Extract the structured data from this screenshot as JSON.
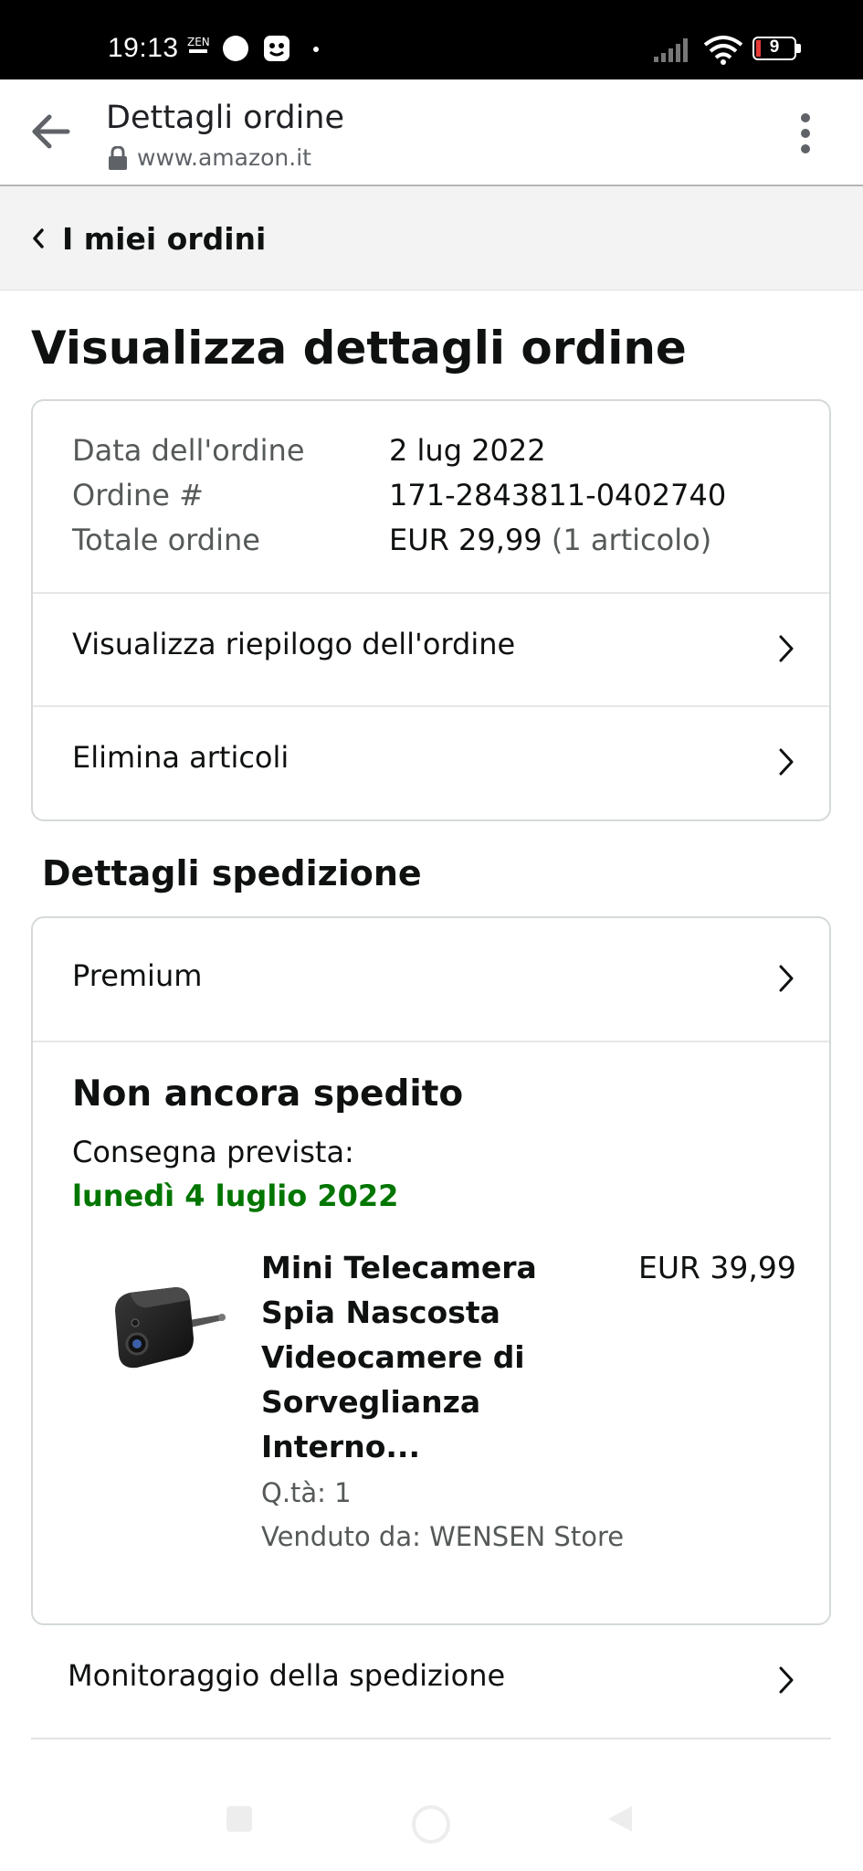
{
  "status_bar": {
    "time": "19:13",
    "zen_label_top": "ZEN",
    "battery_level": "9"
  },
  "toolbar": {
    "title": "Dettagli ordine",
    "url": "www.amazon.it"
  },
  "breadcrumb": {
    "label": "I miei ordini"
  },
  "page_title": "Visualizza dettagli ordine",
  "order_summary": {
    "date_label": "Data dell'ordine",
    "date_value": "2 lug 2022",
    "number_label": "Ordine #",
    "number_value": "171-2843811-0402740",
    "total_label": "Totale ordine",
    "total_value": "EUR 29,99",
    "total_items": "(1 articolo)"
  },
  "order_actions": {
    "view_summary": "Visualizza riepilogo dell'ordine",
    "delete_items": "Elimina articoli"
  },
  "shipping": {
    "section_title": "Dettagli spedizione",
    "shipping_method": "Premium",
    "status": "Non ancora spedito",
    "expected_label": "Consegna prevista:",
    "expected_date": "lunedì 4 luglio 2022",
    "product": {
      "title": "Mini Telecamera Spia Nascosta Videocamere di Sorveglianza Interno...",
      "price": "EUR 39,99",
      "quantity": "Q.tà: 1",
      "seller": "Venduto da: WENSEN Store"
    },
    "tracking_label": "Monitoraggio della spedizione"
  },
  "colors": {
    "delivery_green": "#007600",
    "secondary_text": "#565959",
    "card_border": "#d5d9d9",
    "breadcrumb_bg": "#f3f3f3"
  }
}
